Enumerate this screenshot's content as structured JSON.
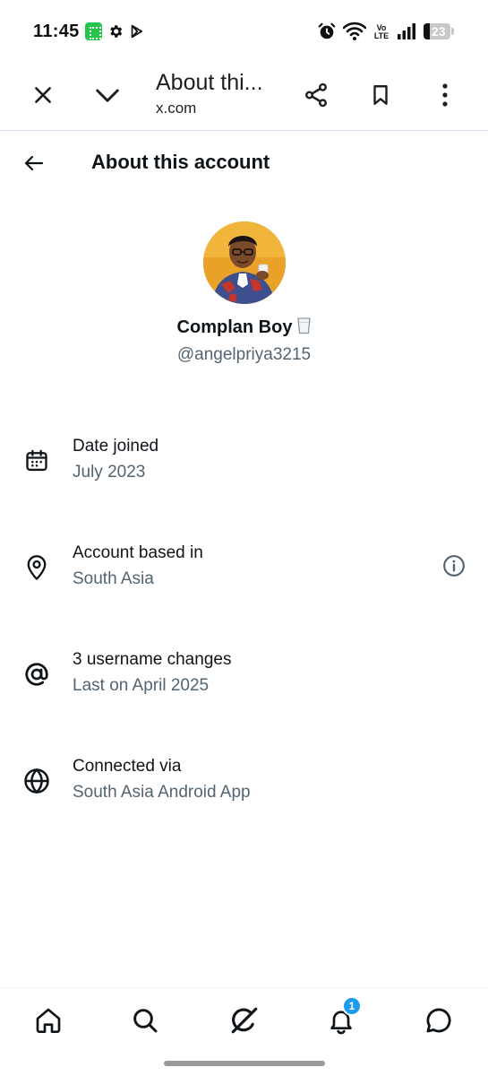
{
  "status_bar": {
    "time": "11:45",
    "volte_top": "Vo",
    "volte_bottom": "LTE",
    "battery_level": 23,
    "battery_text": "23",
    "icons": [
      "app-notification-icon",
      "gear-icon",
      "play-store-icon",
      "alarm-icon",
      "wifi-icon",
      "volte-icon",
      "signal-icon",
      "battery-icon"
    ]
  },
  "browser": {
    "title": "About thi...",
    "url": "x.com",
    "icons": [
      "close-icon",
      "chevron-down-icon",
      "share-icon",
      "bookmark-icon",
      "more-vertical-icon"
    ]
  },
  "page": {
    "title": "About this account"
  },
  "profile": {
    "display_name": "Complan Boy",
    "handle": "@angelpriya3215",
    "name_emoji": "glass-of-milk-icon"
  },
  "info": [
    {
      "icon": "calendar-icon",
      "title": "Date joined",
      "subtitle": "July 2023"
    },
    {
      "icon": "location-pin-icon",
      "title": "Account based in",
      "subtitle": "South Asia",
      "action_icon": "info-icon"
    },
    {
      "icon": "at-sign-icon",
      "title": "3 username changes",
      "subtitle": "Last on April 2025"
    },
    {
      "icon": "globe-icon",
      "title": "Connected via",
      "subtitle": "South Asia Android App"
    }
  ],
  "bottom_nav": {
    "items": [
      "home-icon",
      "search-icon",
      "grok-icon",
      "notifications-icon",
      "messages-icon"
    ],
    "notification_count": "1"
  },
  "colors": {
    "primary_text": "#0f1419",
    "secondary_text": "#536471",
    "accent": "#1d9bf0",
    "divider": "#cfdbe8"
  }
}
